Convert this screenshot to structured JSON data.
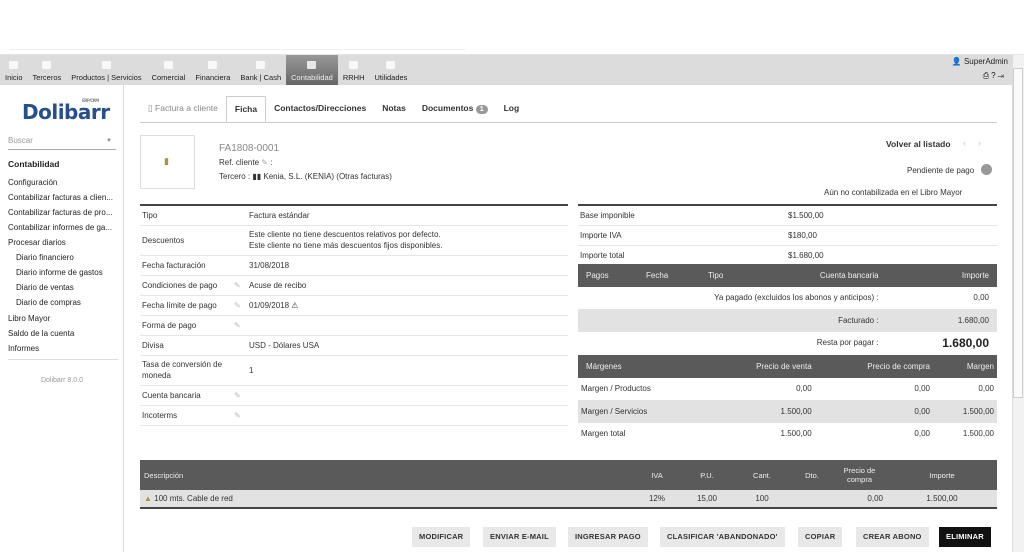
{
  "nav": {
    "items": [
      "Inicio",
      "Terceros",
      "Productos | Servicios",
      "Comercial",
      "Financiera",
      "Bank | Cash",
      "Contabilidad",
      "RRHH",
      "Utilidades"
    ],
    "active": "Contabilidad",
    "user": "SuperAdmin",
    "icons": [
      "print-icon",
      "help-icon",
      "logout-icon"
    ]
  },
  "sidebar": {
    "logo": "Dolibarr",
    "logo_sub": "ERP/CRM",
    "search_placeholder": "Buscar",
    "section": "Contabilidad",
    "items": [
      "Configuración",
      "Contabilizar facturas a clien...",
      "Contabilizar facturas de pro...",
      "Contabilizar informes de ga...",
      "Procesar diarios"
    ],
    "subitems": [
      "Diario financiero",
      "Diario informe de gastos",
      "Diario de ventas",
      "Diario de compras"
    ],
    "items2": [
      "Libro Mayor",
      "Saldo de la cuenta",
      "Informes"
    ],
    "version": "Dolibarr 8.0.0"
  },
  "tabs": {
    "first": "Factura a cliente",
    "items": [
      "Ficha",
      "Contactos/Direcciones",
      "Notas",
      "Documentos",
      "Log"
    ],
    "documents_count": "1"
  },
  "header": {
    "ref": "FA1808-0001",
    "ref_cliente": "Ref. cliente",
    "tercero": "Tercero : ▮▮ Kenia, S.L. (KENIA) (Otras facturas)",
    "back": "Volver al listado",
    "status": "Pendiente de pago",
    "ledger": "Aún no contabilizada en el Libro Mayor"
  },
  "fields": [
    {
      "label": "Tipo",
      "value": "Factura estándar"
    },
    {
      "label": "Descuentos",
      "value": "Este cliente no tiene descuentos relativos por defecto.",
      "value2": "Este cliente no tiene más descuentos fijos disponibles."
    },
    {
      "label": "Fecha facturación",
      "value": "31/08/2018"
    },
    {
      "label": "Condiciones de pago",
      "value": "Acuse de recibo"
    },
    {
      "label": "Fecha límite de pago",
      "value": "01/09/2018 ⚠"
    },
    {
      "label": "Forma de pago",
      "value": ""
    },
    {
      "label": "Divisa",
      "value": "USD - Dólares USA"
    },
    {
      "label": "Tasa de conversión de moneda",
      "value": "1"
    },
    {
      "label": "Cuenta bancaria",
      "value": ""
    },
    {
      "label": "Incoterms",
      "value": ""
    }
  ],
  "amounts": [
    {
      "label": "Base imponible",
      "value": "$1.500,00"
    },
    {
      "label": "Importe IVA",
      "value": "$180,00"
    },
    {
      "label": "Importe total",
      "value": "$1.680,00"
    }
  ],
  "payments": {
    "headers": [
      "Pagos",
      "Fecha",
      "Tipo",
      "Cuenta bancaria",
      "Importe"
    ],
    "paid_label": "Ya pagado (excluidos los abonos y anticipos) :",
    "paid": "0,00",
    "billed_label": "Facturado :",
    "billed": "1.680,00",
    "remaining_label": "Resta por pagar :",
    "remaining": "1.680,00"
  },
  "margins": {
    "headers": [
      "Márgenes",
      "Precio de venta",
      "Precio de compra",
      "Margen"
    ],
    "rows": [
      [
        "Margen / Productos",
        "0,00",
        "0,00",
        "0,00"
      ],
      [
        "Margen / Servicios",
        "1.500,00",
        "0,00",
        "1.500,00"
      ],
      [
        "Margen total",
        "1.500,00",
        "0,00",
        "1.500,00"
      ]
    ]
  },
  "lines": {
    "headers": [
      "Descripción",
      "IVA",
      "P.U.",
      "Cant.",
      "Dto.",
      "Precio de compra",
      "Importe"
    ],
    "rows": [
      [
        "100 mts. Cable de red",
        "12%",
        "15,00",
        "100",
        "",
        "0,00",
        "1.500,00"
      ]
    ]
  },
  "actions": [
    "MODIFICAR",
    "ENVIAR E-MAIL",
    "INGRESAR PAGO",
    "CLASIFICAR 'ABANDONADO'",
    "COPIAR",
    "CREAR ABONO",
    "ELIMINAR"
  ]
}
